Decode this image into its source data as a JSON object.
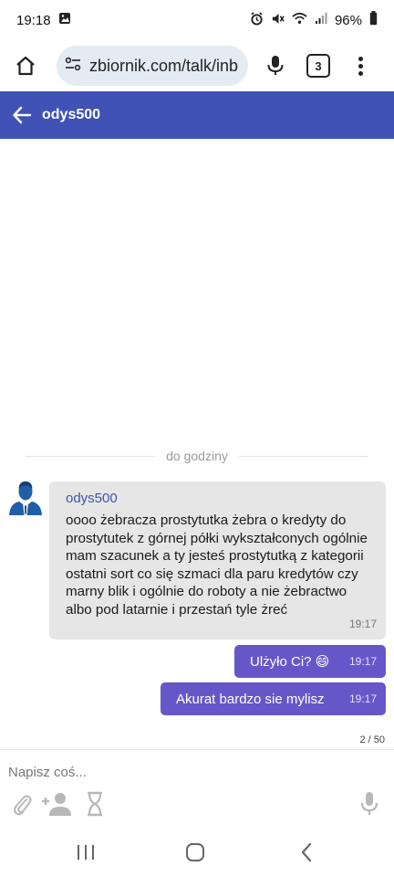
{
  "status_bar": {
    "time": "19:18",
    "battery": "96%"
  },
  "browser": {
    "url": "zbiornik.com/talk/inb",
    "tab_count": "3"
  },
  "header": {
    "title": "odys500"
  },
  "chat": {
    "divider_label": "do godziny",
    "incoming": {
      "sender": "odys500",
      "text": "oooo żebracza prostytutka żebra o kredyty do prostytutek z górnej półki wykształconych ogólnie mam szacunek a ty jesteś prostytutką z kategorii ostatni sort co się szmaci dla paru kredytów czy marny blik i ogólnie do roboty a nie żebractwo albo pod latarnie i przestań tyle żreć",
      "time": "19:17"
    },
    "outgoing": [
      {
        "text": "Ulżyło Ci? 😄",
        "time": "19:17"
      },
      {
        "text": "Akurat bardzo sie mylisz",
        "time": "19:17"
      }
    ],
    "page_count": "2 / 50"
  },
  "compose": {
    "placeholder": "Napisz coś..."
  },
  "colors": {
    "header": "#4052b5",
    "outgoing_bubble": "#6657c9",
    "incoming_bubble": "#e6e6e6",
    "sender_name": "#3c57a8"
  },
  "icons": {
    "status": [
      "gallery-icon",
      "alarm-icon",
      "mute-icon",
      "wifi-icon",
      "signal-icon",
      "battery-icon"
    ],
    "browser": [
      "home-icon",
      "site-settings-icon",
      "mic-icon",
      "tabs-icon",
      "more-icon"
    ],
    "compose": [
      "attach-icon",
      "add-user-icon",
      "timer-icon",
      "mic-icon"
    ],
    "nav": [
      "recent-apps-icon",
      "home-icon",
      "back-icon"
    ]
  }
}
